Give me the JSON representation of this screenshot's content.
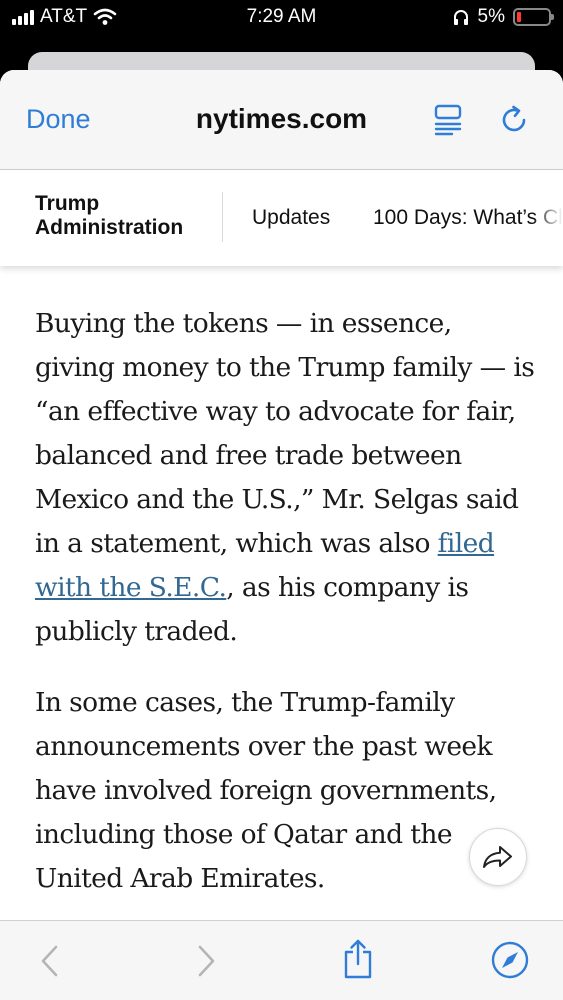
{
  "status_bar": {
    "carrier": "AT&T",
    "time": "7:29 AM",
    "battery_percent": "5%"
  },
  "browser": {
    "done_label": "Done",
    "domain": "nytimes.com"
  },
  "section_nav": {
    "title_line1": "Trump",
    "title_line2": "Administration",
    "links": [
      "Updates",
      "100 Days: What’s Cl"
    ]
  },
  "article": {
    "p1_before_link": "Buying the tokens — in essence, giving money to the Trump family — is “an effective way to advocate for fair, balanced and free trade between Mexico and the U.S.,” Mr. Selgas said in a statement, which was also ",
    "p1_link": "filed with the S.E.C.",
    "p1_after_link": ", as his company is publicly traded.",
    "p2": "In some cases, the Trump-family announcements over the past week have involved foreign governments, including those of Qatar and the United Arab Emirates."
  },
  "colors": {
    "accent": "#2f7dd6",
    "link": "#326891",
    "battery_low": "#ff3b30",
    "disabled": "#b5b5b5"
  },
  "icons": [
    "signal-icon",
    "wifi-icon",
    "headphones-icon",
    "battery-icon",
    "reader-icon",
    "reload-icon",
    "share-arrow-icon",
    "back-icon",
    "forward-icon",
    "share-icon",
    "compass-icon"
  ]
}
